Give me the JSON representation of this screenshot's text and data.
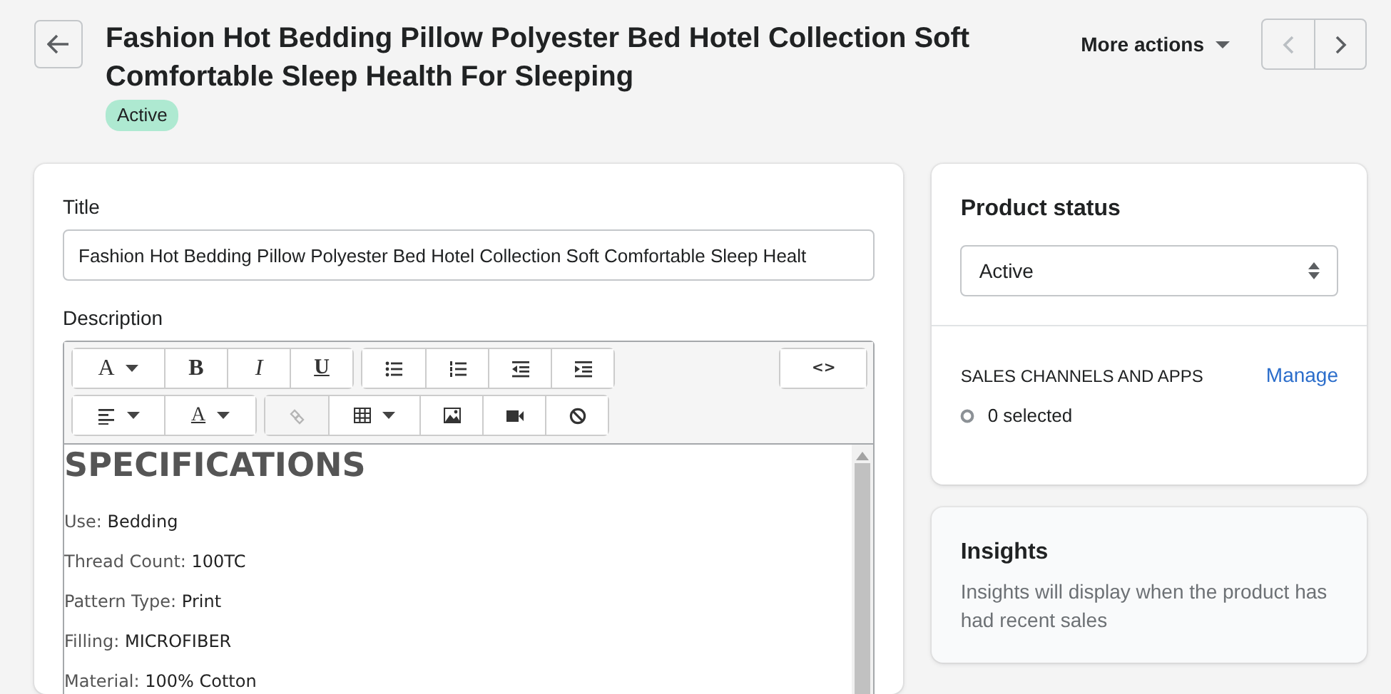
{
  "header": {
    "title": "Fashion Hot Bedding Pillow Polyester Bed Hotel Collection Soft Comfortable Sleep Health For Sleeping",
    "status_badge": "Active",
    "more_actions": "More actions",
    "prev_disabled": true,
    "next_disabled": false
  },
  "title_field": {
    "label": "Title",
    "value": "Fashion Hot Bedding Pillow Polyester Bed Hotel Collection Soft Comfortable Sleep Healt"
  },
  "description": {
    "label": "Description",
    "toolbar": [
      [
        [
          {
            "kind": "letter",
            "label": "A",
            "dropdown": true,
            "disabled": false
          },
          {
            "kind": "bold",
            "label": "B",
            "dropdown": false,
            "disabled": false
          },
          {
            "kind": "italic",
            "label": "I",
            "dropdown": false,
            "disabled": false
          },
          {
            "kind": "underline",
            "label": "U",
            "dropdown": false,
            "disabled": false
          }
        ],
        [
          {
            "kind": "bullets",
            "dropdown": false,
            "disabled": false
          },
          {
            "kind": "numbers",
            "dropdown": false,
            "disabled": false
          },
          {
            "kind": "outdent",
            "dropdown": false,
            "disabled": false
          },
          {
            "kind": "indent",
            "dropdown": false,
            "disabled": false
          }
        ],
        [
          {
            "kind": "code",
            "label": "<>",
            "dropdown": false,
            "disabled": false
          }
        ]
      ],
      [
        [
          {
            "kind": "align",
            "dropdown": true,
            "disabled": false
          },
          {
            "kind": "color",
            "label": "A",
            "dropdown": true,
            "disabled": false
          }
        ],
        [
          {
            "kind": "link",
            "dropdown": false,
            "disabled": true
          },
          {
            "kind": "table",
            "dropdown": true,
            "disabled": false
          },
          {
            "kind": "image",
            "dropdown": false,
            "disabled": false
          },
          {
            "kind": "video",
            "dropdown": false,
            "disabled": false
          },
          {
            "kind": "clear",
            "dropdown": false,
            "disabled": false
          }
        ]
      ]
    ],
    "heading": "SPECIFICATIONS",
    "specs": [
      {
        "label": "Use:",
        "value": "Bedding"
      },
      {
        "label": "Thread Count:",
        "value": "100TC"
      },
      {
        "label": "Pattern Type:",
        "value": "Print"
      },
      {
        "label": "Filling:",
        "value": "MICROFIBER"
      },
      {
        "label": "Material:",
        "value": "100% Cotton"
      }
    ]
  },
  "product_status": {
    "title": "Product status",
    "value": "Active",
    "channels_heading": "SALES CHANNELS AND APPS",
    "manage_link": "Manage",
    "selected_count": "0 selected"
  },
  "insights": {
    "title": "Insights",
    "text": "Insights will display when the product has had recent sales"
  }
}
